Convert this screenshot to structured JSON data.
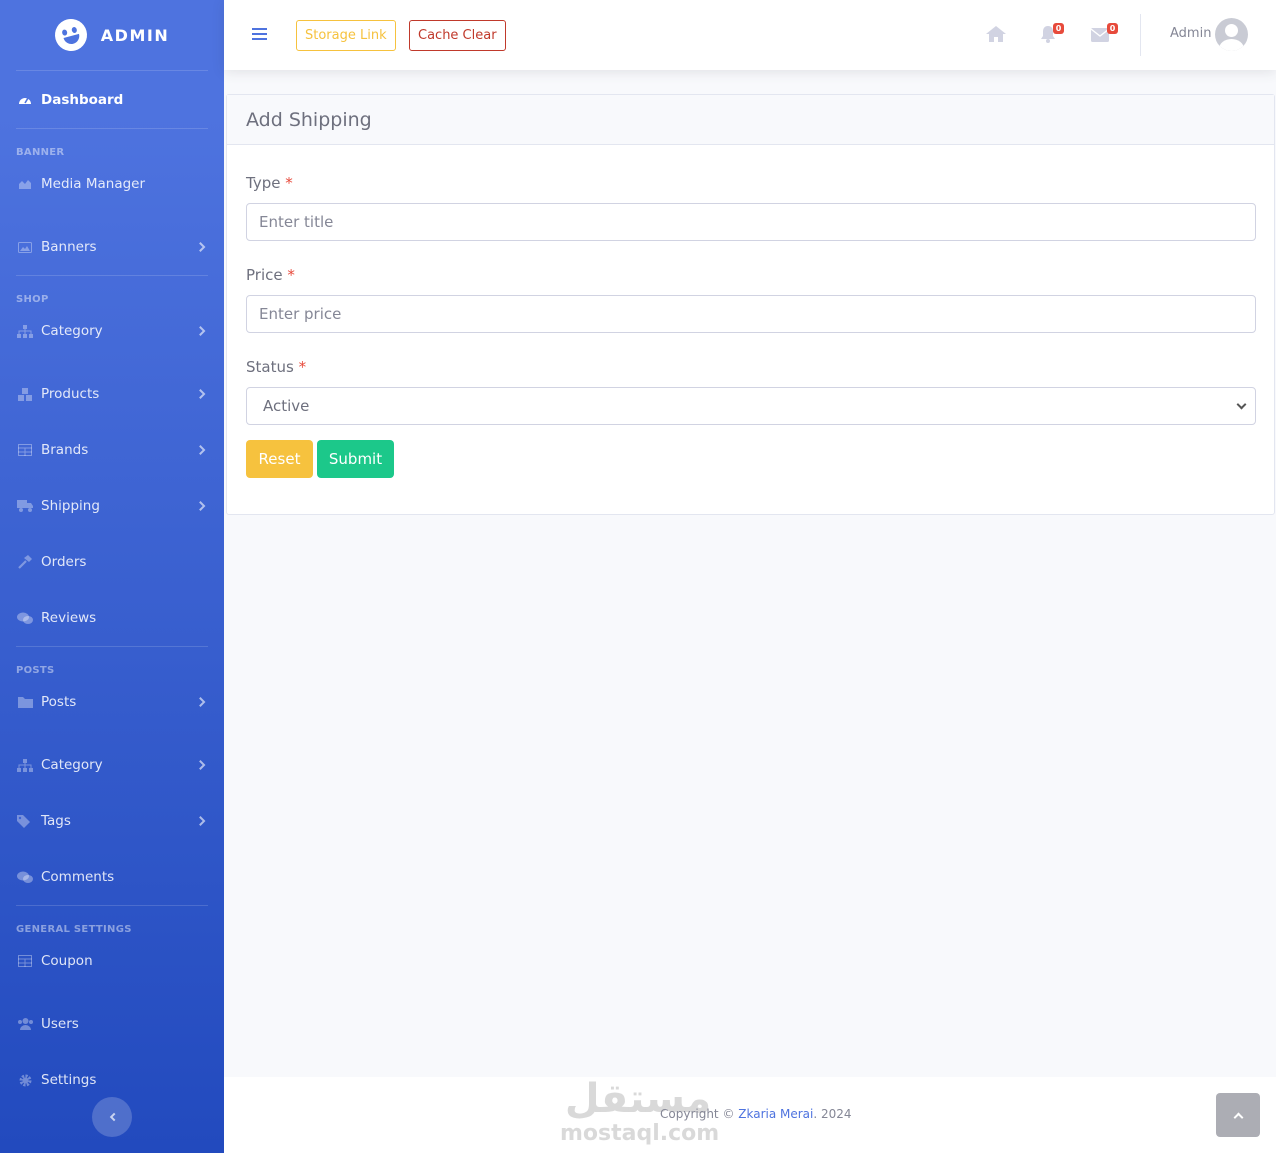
{
  "brand": {
    "name": "ADMIN"
  },
  "sidebar": {
    "dashboard": "Dashboard",
    "headings": [
      "Banner",
      "Shop",
      "Posts",
      "General Settings"
    ],
    "items": [
      {
        "label": "Media Manager",
        "icon": "chart-area-icon"
      },
      {
        "label": "Banners",
        "icon": "image-icon"
      },
      {
        "label": "Category",
        "icon": "sitemap-icon"
      },
      {
        "label": "Products",
        "icon": "cubes-icon"
      },
      {
        "label": "Brands",
        "icon": "table-icon"
      },
      {
        "label": "Shipping",
        "icon": "truck-icon"
      },
      {
        "label": "Orders",
        "icon": "hammer-icon"
      },
      {
        "label": "Reviews",
        "icon": "comments-icon"
      },
      {
        "label": "Posts",
        "icon": "folder-icon"
      },
      {
        "label": "Category",
        "icon": "sitemap-icon"
      },
      {
        "label": "Tags",
        "icon": "tags-icon"
      },
      {
        "label": "Comments",
        "icon": "comments-icon"
      },
      {
        "label": "Coupon",
        "icon": "table-icon"
      },
      {
        "label": "Users",
        "icon": "users-icon"
      },
      {
        "label": "Settings",
        "icon": "cog-icon"
      }
    ]
  },
  "topbar": {
    "storage_link": "Storage Link",
    "cache_clear": "Cache Clear",
    "alerts_count": "0",
    "messages_count": "0",
    "user_name": "Admin"
  },
  "form": {
    "title": "Add Shipping",
    "type_label": "Type",
    "type_placeholder": "Enter title",
    "price_label": "Price",
    "price_placeholder": "Enter price",
    "status_label": "Status",
    "status_value": "Active",
    "required_mark": "*",
    "reset_label": "Reset",
    "submit_label": "Submit"
  },
  "footer": {
    "copyright_prefix": "Copyright © ",
    "author": "Zkaria Merai",
    "year_suffix": ". 2024",
    "watermark_ar": "مستقل",
    "watermark_en": "mostaql.com"
  },
  "colors": {
    "primary": "#4e73df",
    "warning": "#f6c23e",
    "success": "#1cc88a",
    "danger": "#e74a3b"
  }
}
